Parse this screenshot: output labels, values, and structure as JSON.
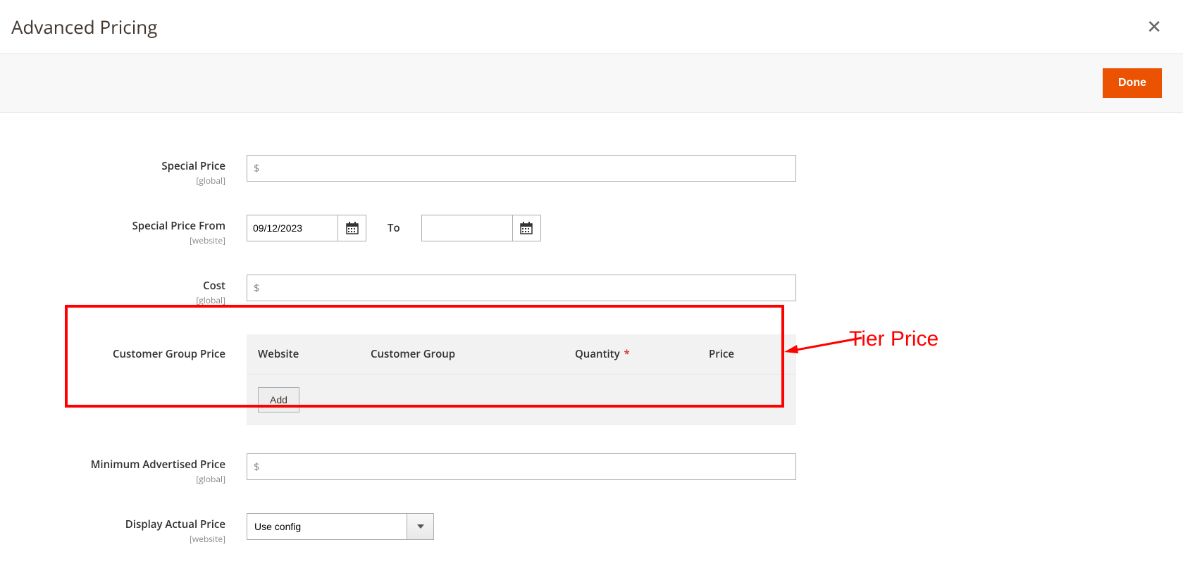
{
  "modal": {
    "title": "Advanced Pricing",
    "done_label": "Done"
  },
  "fields": {
    "special_price": {
      "label": "Special Price",
      "scope": "[global]",
      "prefix": "$",
      "value": ""
    },
    "special_price_from": {
      "label": "Special Price From",
      "scope": "[website]",
      "from_value": "09/12/2023",
      "to_label": "To",
      "to_value": ""
    },
    "cost": {
      "label": "Cost",
      "scope": "[global]",
      "prefix": "$",
      "value": ""
    },
    "customer_group_price": {
      "label": "Customer Group Price",
      "headers": {
        "website": "Website",
        "customer_group": "Customer Group",
        "quantity": "Quantity",
        "price": "Price"
      },
      "required_mark": "*",
      "add_label": "Add"
    },
    "map": {
      "label": "Minimum Advertised Price",
      "scope": "[global]",
      "prefix": "$",
      "value": ""
    },
    "display_actual": {
      "label": "Display Actual Price",
      "scope": "[website]",
      "value": "Use config"
    }
  },
  "annotation": {
    "text": "Tier Price"
  }
}
